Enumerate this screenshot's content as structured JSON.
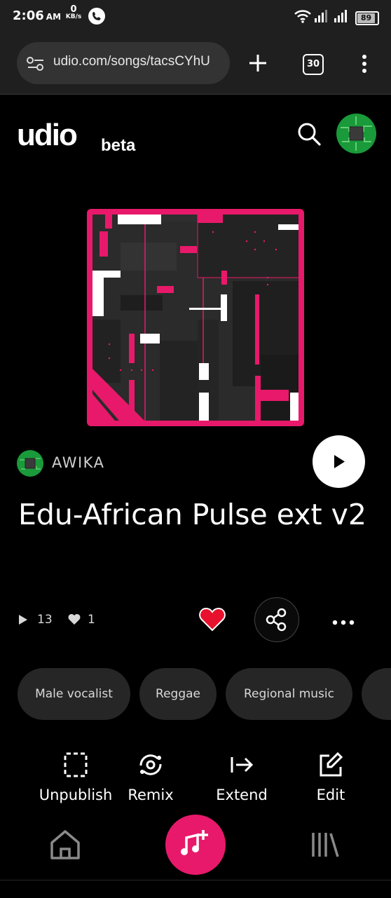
{
  "status_bar": {
    "time": "2:06",
    "ampm": "AM",
    "net_speed": "0",
    "net_unit": "KB/s",
    "battery": "89"
  },
  "browser": {
    "url": "udio.com/songs/tacsCYhU",
    "tab_count": "30"
  },
  "header": {
    "logo": "udio",
    "logo_suffix": "beta"
  },
  "song": {
    "artist": "AWIKA",
    "title": "Edu-African Pulse ext v2",
    "plays": "13",
    "likes": "1",
    "tags": [
      "Male vocalist",
      "Reggae",
      "Regional music"
    ]
  },
  "actions": [
    {
      "label": "Unpublish",
      "icon": "unpublish-icon"
    },
    {
      "label": "Remix",
      "icon": "remix-icon"
    },
    {
      "label": "Extend",
      "icon": "extend-icon"
    },
    {
      "label": "Edit",
      "icon": "edit-icon"
    }
  ],
  "bottom_nav": [
    {
      "icon": "home-icon"
    },
    {
      "icon": "create-music-icon"
    },
    {
      "icon": "library-icon"
    }
  ],
  "colors": {
    "accent": "#e8196a",
    "like": "#e8112d",
    "background": "#000000"
  }
}
